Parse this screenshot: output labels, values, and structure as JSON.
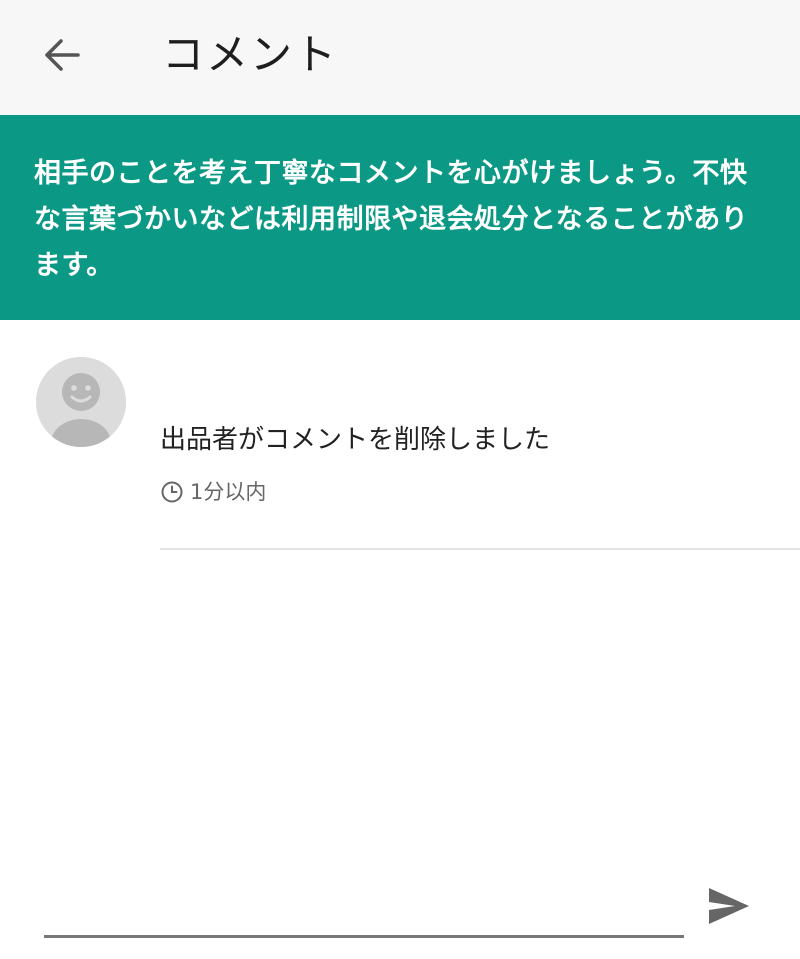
{
  "header": {
    "title": "コメント",
    "back_icon": "arrow-back-icon"
  },
  "notice": {
    "text": "相手のことを考え丁寧なコメントを心がけましょう。不快な言葉づかいなどは利用制限や退会処分となることがあります。"
  },
  "comments": [
    {
      "avatar_icon": "default-avatar-icon",
      "text": "出品者がコメントを削除しました",
      "time": "1分以内",
      "time_icon": "clock-icon"
    }
  ],
  "composer": {
    "value": "",
    "placeholder": "",
    "send_icon": "send-icon"
  },
  "colors": {
    "header_bg": "#f7f7f7",
    "notice_bg": "#0b9985",
    "notice_text": "#ffffff",
    "avatar_bg": "#dcdcdc",
    "icon_gray": "#666666"
  }
}
